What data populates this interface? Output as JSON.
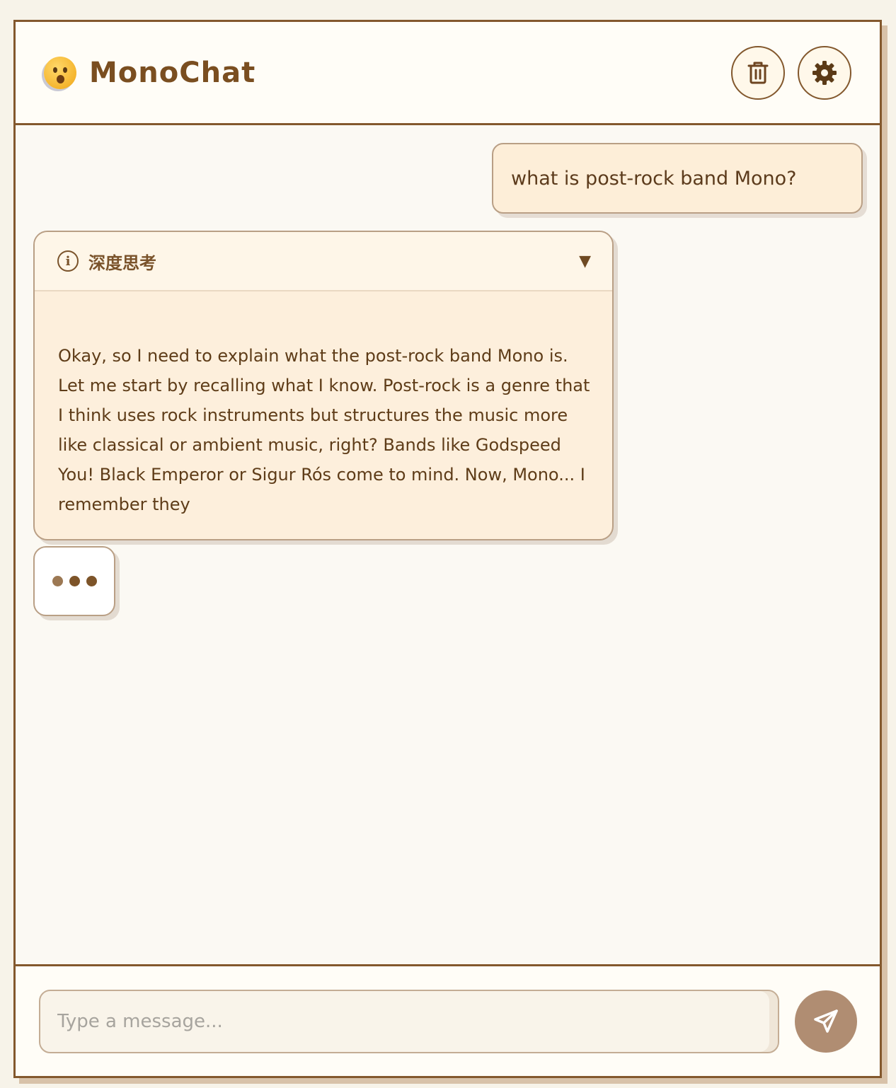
{
  "app": {
    "title": "MonoChat",
    "logo_icon": "astonished-face-emoji-icon"
  },
  "header": {
    "clear_button_icon": "trash-icon",
    "settings_button_icon": "gear-icon"
  },
  "messages": [
    {
      "role": "user",
      "text": "what is post-rock band Mono?"
    },
    {
      "role": "assistant",
      "thinking": {
        "label": "深度思考",
        "icon": "info-icon",
        "toggle": "▼",
        "text": "Okay, so I need to explain what the post-rock band Mono is. Let me start by recalling what I know. Post-rock is a genre that I think uses rock instruments but structures the music more like classical or ambient music, right? Bands like Godspeed You! Black Emperor or Sigur Rós come to mind. Now, Mono... I remember they"
      },
      "typing_indicator": true
    }
  ],
  "composer": {
    "placeholder": "Type a message...",
    "value": "",
    "send_icon": "send-arrow-icon"
  },
  "colors": {
    "accent": "#83582d",
    "bubble": "#fdeed8",
    "send_button": "#b08d72"
  }
}
